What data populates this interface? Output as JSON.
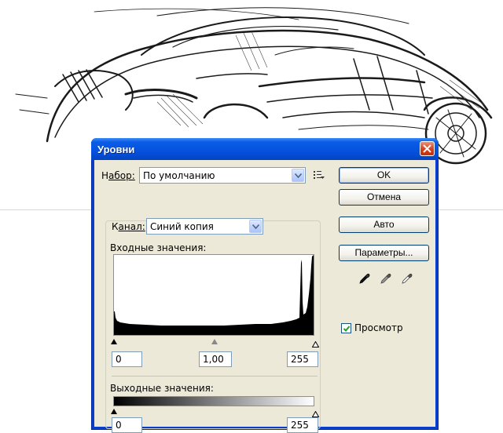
{
  "dialog": {
    "title": "Уровни",
    "preset": {
      "label_prefix": "Н",
      "label_rest": "абор:",
      "value": "По умолчанию"
    },
    "channel": {
      "label_prefix": "К",
      "label_rest": "анал:",
      "value": "Синий копия"
    },
    "input_levels": {
      "label": "Входные значения:",
      "black": "0",
      "gamma": "1,00",
      "white": "255"
    },
    "output_levels": {
      "label": "Выходные значения:",
      "black": "0",
      "white": "255"
    },
    "buttons": {
      "ok": "OK",
      "cancel": "Отмена",
      "auto": "Авто",
      "options": "Параметры..."
    },
    "preview": {
      "label": "Просмотр",
      "checked": true
    },
    "eyedroppers": [
      "black-point-eyedropper-icon",
      "gray-point-eyedropper-icon",
      "white-point-eyedropper-icon"
    ],
    "colors": {
      "title_bar": "#0452dd",
      "dialog_bg": "#ece9d8",
      "close_button": "#d2401f"
    }
  }
}
